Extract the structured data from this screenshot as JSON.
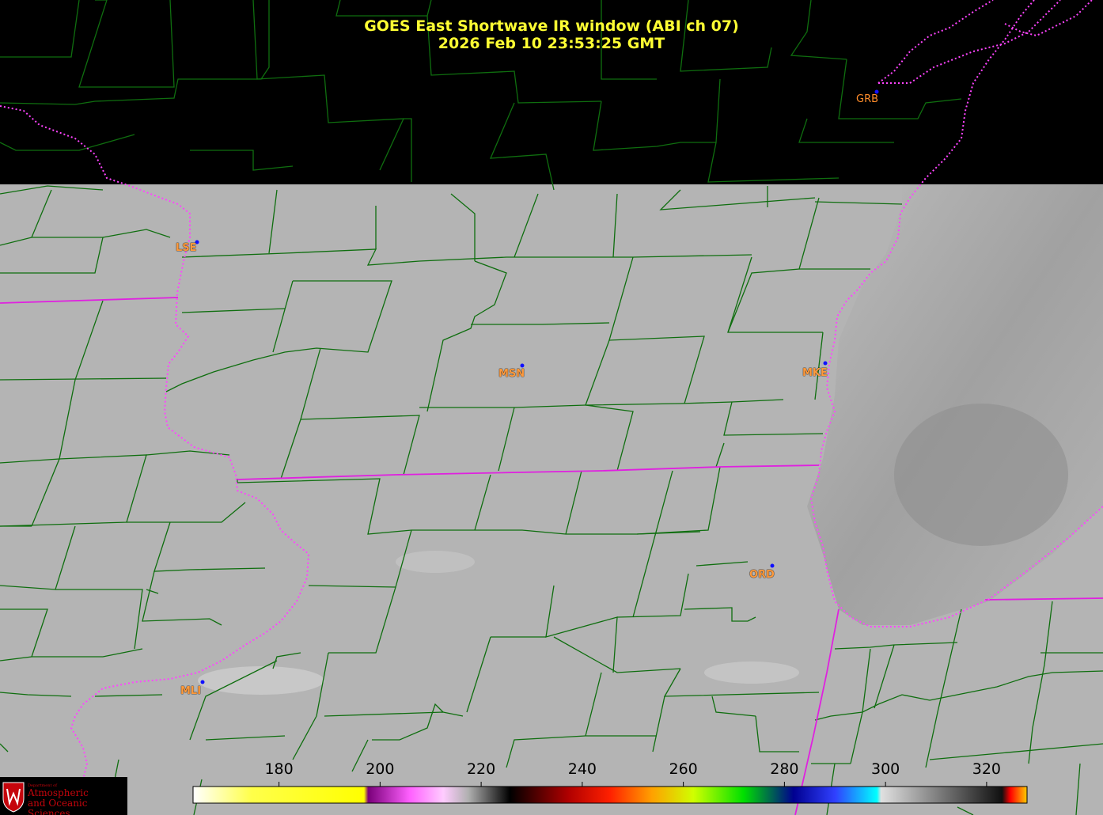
{
  "header": {
    "title": "GOES East Shortwave IR window (ABI ch 07)",
    "timestamp": "2026 Feb 10  23:53:25 GMT"
  },
  "stations": [
    {
      "code": "GRB"
    },
    {
      "code": "LSE"
    },
    {
      "code": "MSN"
    },
    {
      "code": "MKE"
    },
    {
      "code": "ORD"
    },
    {
      "code": "MLI"
    }
  ],
  "colorbar": {
    "ticks": [
      "180",
      "200",
      "220",
      "240",
      "260",
      "280",
      "300",
      "320"
    ],
    "range": [
      163,
      328
    ],
    "units": ""
  },
  "logo": {
    "dept_line": "Department of",
    "line1": "Atmospheric",
    "line2": "and Oceanic Sciences"
  },
  "colors": {
    "title": "#ffff33",
    "county_lines": "#0f6e0f",
    "state_lines": "#e020e0",
    "station_label": "#ff9a3c",
    "station_dot": "#1010ff"
  }
}
